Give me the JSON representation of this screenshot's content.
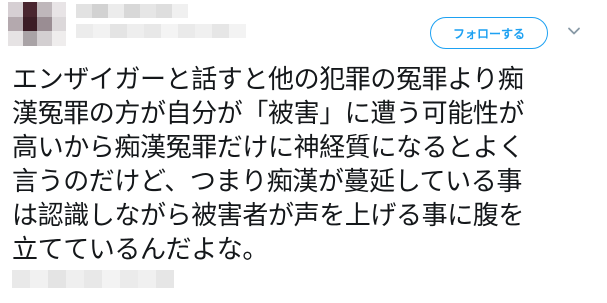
{
  "tweet": {
    "follow_label": "フォローする",
    "text": "エンザイガーと話すと他の犯罪の冤罪より痴\n漢冤罪の方が自分が「被害」に遭う可能性が\n高いから痴漢冤罪だけに神経質になるとよく\n言うのだけど、つまり痴漢が蔓延している事\nは認識しながら被害者が声を上げる事に腹を\n立てているんだよな。",
    "accent_color": "#1da1f2",
    "text_color": "#14171a",
    "icons": {
      "menu": "chevron-down-icon"
    }
  },
  "censored": {
    "avatar_colors": [
      "#d6cfd3",
      "#4a2630",
      "#bfb7bb",
      "#e8e4e6",
      "#b4a9ae",
      "#3c1d26",
      "#9a8d93",
      "#dcd8da",
      "#e6e3e4",
      "#a9a3a6",
      "#d3cfd1",
      "#efeded"
    ],
    "name_colors": [
      "#e2e2e2",
      "#d2d2d2",
      "#ececec",
      "#d8d8d8",
      "#e6e6e6",
      "#dedede",
      "#f0f0f0"
    ],
    "handle_colors": [
      "#ececec",
      "#f2f2f2",
      "#e4e4e4",
      "#eeeeee",
      "#e8e8e8",
      "#f4f4f4",
      "#eaeaea",
      "#f0f0f0",
      "#e6e6e6",
      "#f3f3f3"
    ],
    "footer_colors": [
      "#e9e9e9",
      "#f1f1f1",
      "#e4e4e4",
      "#efefef",
      "#e8e8e8",
      "#f3f3f3",
      "#ebebeb",
      "#f0f0f0",
      "#e6e6e6"
    ]
  }
}
